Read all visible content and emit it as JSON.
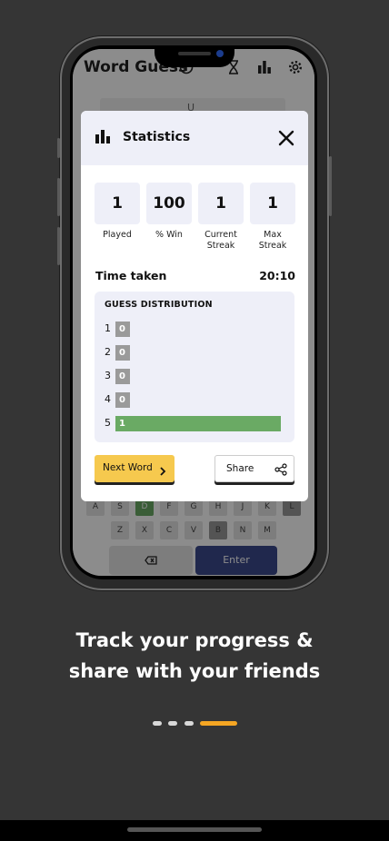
{
  "app": {
    "title": "Word Guess",
    "board_hint": "U"
  },
  "keyboard": {
    "row2": [
      "A",
      "S",
      "D",
      "F",
      "G",
      "H",
      "J",
      "K",
      "L"
    ],
    "row3": [
      "Z",
      "X",
      "C",
      "V",
      "B",
      "N",
      "M"
    ],
    "enter_label": "Enter"
  },
  "modal": {
    "title": "Statistics",
    "stats": [
      {
        "value": "1",
        "label": "Played"
      },
      {
        "value": "100",
        "label": "% Win"
      },
      {
        "value": "1",
        "label": "Current Streak"
      },
      {
        "value": "1",
        "label": "Max Streak"
      }
    ],
    "time_label": "Time taken",
    "time_value": "20:10",
    "distribution_title": "GUESS DISTRIBUTION",
    "distribution": [
      {
        "guess": "1",
        "count": "0"
      },
      {
        "guess": "2",
        "count": "0"
      },
      {
        "guess": "3",
        "count": "0"
      },
      {
        "guess": "4",
        "count": "0"
      },
      {
        "guess": "5",
        "count": "1"
      }
    ],
    "next_label": "Next Word",
    "share_label": "Share"
  },
  "caption": {
    "line1": "Track your progress &",
    "line2": "share with your friends"
  },
  "pager": {
    "total": 4,
    "active": 4
  },
  "colors": {
    "accent_yellow": "#f6c94e",
    "bar_green": "#6aaa64",
    "bar_gray": "#9a9a9a",
    "page_bg": "#353535",
    "pager_active": "#f5a623",
    "enter_key": "#3b4a8c"
  }
}
